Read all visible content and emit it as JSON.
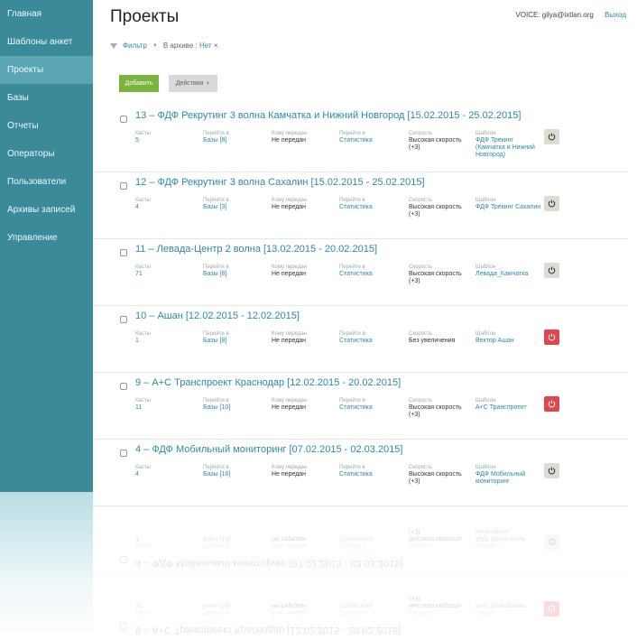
{
  "sidebar": {
    "items": [
      {
        "label": "Главная"
      },
      {
        "label": "Шаблоны анкет"
      },
      {
        "label": "Проекты"
      },
      {
        "label": "Базы"
      },
      {
        "label": "Отчеты"
      },
      {
        "label": "Операторы"
      },
      {
        "label": "Пользователи"
      },
      {
        "label": "Архивы записей"
      },
      {
        "label": "Управление"
      }
    ],
    "active_index": 2
  },
  "header": {
    "title": "Проекты",
    "user": "VOICE: gilya@ixtlan.org",
    "logout": "Выход"
  },
  "filter": {
    "label": "Фильтр",
    "archive_label": "В архиве :",
    "archive_value": "Нет",
    "clear": "×"
  },
  "toolbar": {
    "add_label": "Добавить",
    "actions_label": "Действия"
  },
  "labels": {
    "casts": "Касты",
    "goto_bases": "Перейти в",
    "transferred_to": "Кому передан",
    "goto_stats": "Перейти в",
    "speed": "Скорость",
    "template": "Шаблон"
  },
  "projects": [
    {
      "title": "13 – ФДФ Рекрутинг 3 волна Камчатка и Нижний Новгород [15.02.2015 - 25.02.2015]",
      "casts": "5",
      "bases": "Базы [8]",
      "transferred": "Не передан",
      "stats": "Статистика",
      "speed": "Высокая скорость (+3)",
      "template": "ФДФ Трекинг (Камчатка и Нижний Новгород)",
      "power": "off"
    },
    {
      "title": "12 – ФДФ Рекрутинг 3 волна Сахалин [15.02.2015 - 25.02.2015]",
      "casts": "4",
      "bases": "Базы [3]",
      "transferred": "Не передан",
      "stats": "Статистика",
      "speed": "Высокая скорость (+3)",
      "template": "ФДФ Трекинг Сахалин",
      "power": "off"
    },
    {
      "title": "11 – Левада-Центр 2 волна [13.02.2015 - 20.02.2015]",
      "casts": "71",
      "bases": "Базы [8]",
      "transferred": "Не передан",
      "stats": "Статистика",
      "speed": "Высокая скорость (+3)",
      "template": "Левада_Камчатка",
      "power": "off"
    },
    {
      "title": "10 – Ашан [12.02.2015 - 12.02.2015]",
      "casts": "1",
      "bases": "Базы [8]",
      "transferred": "Не передан",
      "stats": "Статистика",
      "speed": "Без увеличения",
      "template": "Вектор Ашан",
      "power": "on"
    },
    {
      "title": "9 – А+С Транспроект Краснодар [12.02.2015 - 20.02.2015]",
      "casts": "11",
      "bases": "Базы [10]",
      "transferred": "Не передан",
      "stats": "Статистика",
      "speed": "Высокая скорость (+3)",
      "template": "А+С Транспроект",
      "power": "on"
    },
    {
      "title": "4 – ФДФ Мобильный мониторинг [07.02.2015 - 02.03.2015]",
      "casts": "4",
      "bases": "Базы [16]",
      "transferred": "Не передан",
      "stats": "Статистика",
      "speed": "Высокая скорость (+3)",
      "template": "ФДФ Мобильный мониторинг",
      "power": "off"
    }
  ],
  "colors": {
    "sidebar": "#3a8a9a",
    "sidebar_active": "#5aa6b5",
    "link": "#2e8aa5",
    "add_button": "#7ab33e",
    "power_on": "#e0474c",
    "power_off": "#dcdcd2"
  }
}
